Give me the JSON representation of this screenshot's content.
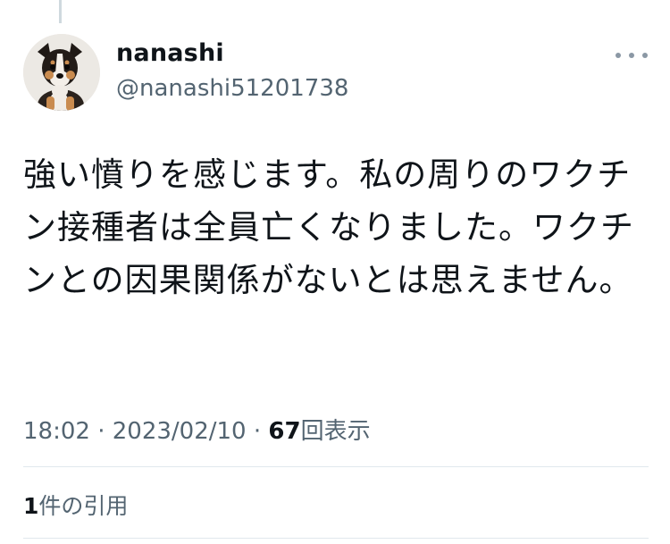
{
  "tweet": {
    "display_name": "nanashi",
    "handle": "@nanashi51201738",
    "text": "強い憤りを感じます。私の周りのワクチン接種者は全員亡くなりました。ワクチンとの因果関係がないとは思えません。",
    "time": "18:02",
    "separator": " · ",
    "date": "2023/02/10",
    "views_count": "67",
    "views_label": "回表示",
    "quote_count": "1",
    "quote_label": "件の引用"
  },
  "icons": {
    "avatar": "dog-avatar-icon",
    "more": "more-options-icon"
  },
  "colors": {
    "text_primary": "#0f1419",
    "text_secondary": "#536471",
    "divider": "#e1e8ed"
  }
}
